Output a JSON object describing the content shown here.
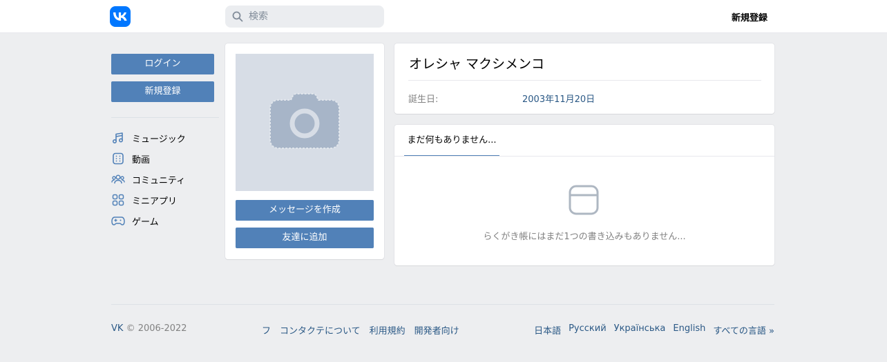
{
  "header": {
    "logo": "vk-logo",
    "search_placeholder": "検索",
    "register_label": "新規登録"
  },
  "sidebar": {
    "login_label": "ログイン",
    "register_label": "新規登録",
    "items": [
      {
        "label": "ミュージック",
        "icon": "music-icon"
      },
      {
        "label": "動画",
        "icon": "video-icon"
      },
      {
        "label": "コミュニティ",
        "icon": "community-icon"
      },
      {
        "label": "ミニアプリ",
        "icon": "mini-apps-icon"
      },
      {
        "label": "ゲーム",
        "icon": "gamepad-icon"
      }
    ]
  },
  "profile": {
    "photo_icon": "camera-icon",
    "message_button": "メッセージを作成",
    "friend_button": "友達に追加",
    "name": "オレシャ マクシメンコ",
    "birthday_label": "誕生日:",
    "birthday_value": "2003年11月20日"
  },
  "wall": {
    "tab_label": "まだ何もありません...",
    "empty_icon": "empty-wall-icon",
    "empty_text": "らくがき帳にはまだ1つの書き込みもありません..."
  },
  "footer": {
    "brand": "VK",
    "copyright": "© 2006-2022",
    "links": [
      "フ",
      "コンタクテについて",
      "利用規約",
      "開発者向け"
    ],
    "languages": [
      "日本語",
      "Русский",
      "Українська",
      "English",
      "すべての言語 »"
    ]
  },
  "colors": {
    "accent": "#5181b8",
    "brand": "#0077ff",
    "link": "#2a5885",
    "background": "#edeef0"
  }
}
